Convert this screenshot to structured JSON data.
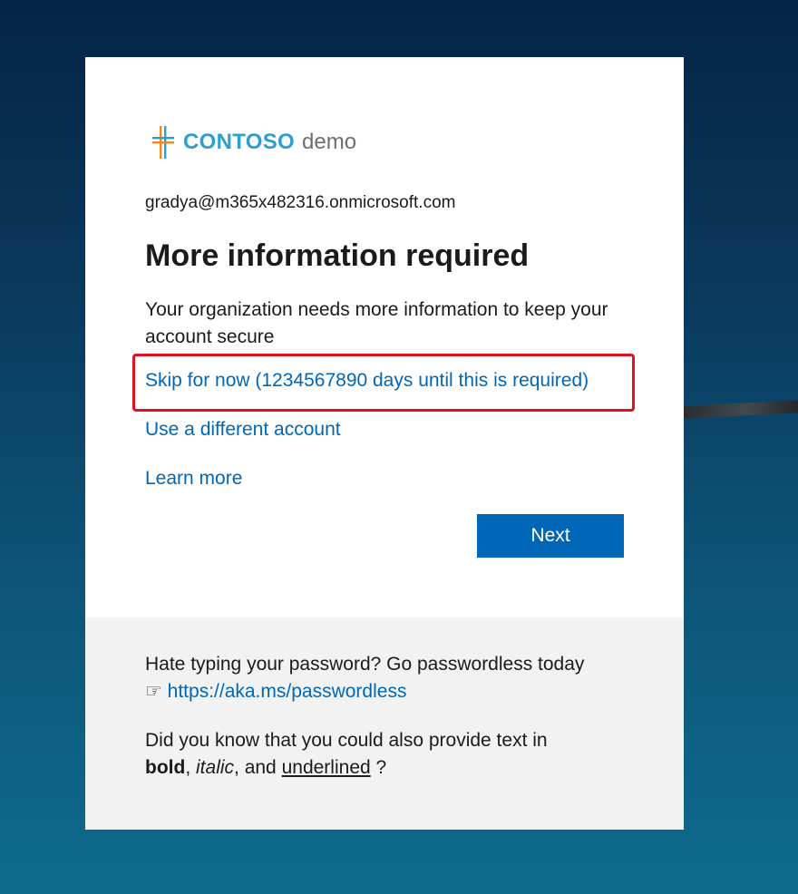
{
  "brand": {
    "icon": "contoso-logo-icon",
    "name": "CONTOSO",
    "suffix": "demo",
    "colors": {
      "brand_blue": "#2b9fd0",
      "logo_orange": "#f08a24",
      "logo_blue": "#2b9fd0",
      "suffix_gray": "#6e6e6e"
    }
  },
  "identity": {
    "email": "gradya@m365x482316.onmicrosoft.com"
  },
  "heading": {
    "title": "More information required"
  },
  "body": {
    "description": "Your organization needs more information to keep your account secure"
  },
  "links": {
    "skip": "Skip for now (1234567890 days until this is required)",
    "different_account": "Use a different account",
    "learn_more": "Learn more"
  },
  "actions": {
    "next_label": "Next",
    "next_color": "#0067b8"
  },
  "footer": {
    "line1_text": "Hate typing your password? Go passwordless today",
    "pointer_glyph": "☞",
    "passwordless_link": "https://aka.ms/passwordless",
    "line2_prefix": "Did you know that you could also provide text in",
    "bold_word": "bold",
    "sep1": ",",
    "italic_word": "italic",
    "sep2": ", and",
    "underlined_word": "underlined",
    "suffix": "?"
  },
  "annotation": {
    "highlight_color": "#e0121e"
  }
}
